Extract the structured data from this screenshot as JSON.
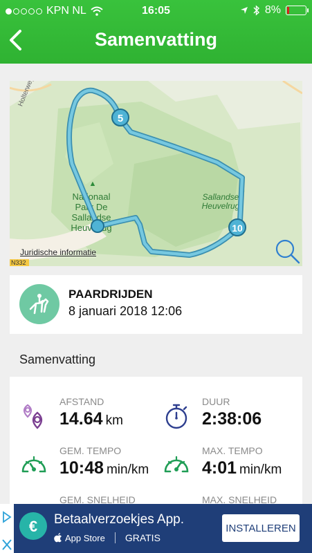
{
  "status_bar": {
    "carrier": "KPN NL",
    "time": "16:05",
    "battery": "8%"
  },
  "header": {
    "title": "Samenvatting",
    "back_icon": "chevron-left-icon"
  },
  "map": {
    "link": "Juridische informatie",
    "park_label": [
      "Nationaal",
      "Park De",
      "Sallandse",
      "Heuvelrug"
    ],
    "area_label": [
      "Sallandse",
      "Heuvelrug"
    ],
    "road_label": "Holterweg",
    "road_shield": "N332",
    "markers": [
      "5",
      "10"
    ]
  },
  "activity": {
    "type": "PAARDRIJDEN",
    "date": "8 januari 2018 12:06",
    "icon": "horse-riding-icon"
  },
  "section_title": "Samenvatting",
  "stats": {
    "distance": {
      "label": "AFSTAND",
      "value": "14.64",
      "unit": "km"
    },
    "duration": {
      "label": "DUUR",
      "value": "2:38:06"
    },
    "avg_pace": {
      "label": "GEM. TEMPO",
      "value": "10:48",
      "unit": "min/km"
    },
    "max_pace": {
      "label": "MAX. TEMPO",
      "value": "4:01",
      "unit": "min/km"
    },
    "avg_speed": {
      "label": "GEM. SNELHEID"
    },
    "max_speed": {
      "label": "MAX. SNELHEID"
    }
  },
  "ad": {
    "title": "Betaalverzoekjes App.",
    "store": "App Store",
    "price": "GRATIS",
    "button": "INSTALLEREN"
  },
  "colors": {
    "header_green": "#34b937",
    "route_blue": "#5bb8d6",
    "stat_purple": "#7b3f91",
    "stat_navy": "#2e3f8f",
    "stat_green": "#1f9d55",
    "ad_blue": "#1f3e78"
  }
}
